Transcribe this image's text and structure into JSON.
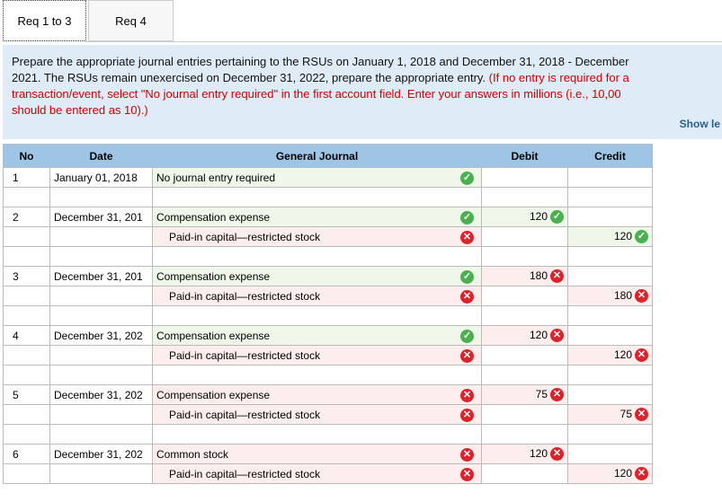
{
  "tabs": [
    {
      "label": "Req 1 to 3"
    },
    {
      "label": "Req 4"
    }
  ],
  "instructions": {
    "line1": "Prepare the appropriate journal entries pertaining to the RSUs on January 1, 2018 and December 31, 2018 - December",
    "line2a": "2021. The RSUs remain unexercised on December 31, 2022, prepare the appropriate entry. ",
    "line2b": "(If no entry is required for a",
    "line3": "transaction/event, select \"No journal entry required\" in the first account field. Enter your answers in millions (i.e., 10,00",
    "line4": "should be entered as 10).)"
  },
  "show_link": "Show le",
  "table": {
    "headers": {
      "no": "No",
      "date": "Date",
      "account": "General Journal",
      "debit": "Debit",
      "credit": "Credit"
    },
    "entries": [
      {
        "no": "1",
        "date": "January 01, 2018",
        "rows": [
          {
            "account": "No journal entry required",
            "acct_ok": true,
            "debit": "",
            "credit": ""
          }
        ]
      },
      {
        "no": "2",
        "date": "December 31, 201",
        "rows": [
          {
            "account": "Compensation expense",
            "acct_ok": true,
            "debit": "120",
            "debit_ok": true,
            "credit": ""
          },
          {
            "account": "Paid-in capital—restricted stock",
            "acct_ok": false,
            "debit": "",
            "credit": "120",
            "credit_ok": true
          }
        ]
      },
      {
        "no": "3",
        "date": "December 31, 201",
        "rows": [
          {
            "account": "Compensation expense",
            "acct_ok": true,
            "debit": "180",
            "debit_ok": false,
            "credit": ""
          },
          {
            "account": "Paid-in capital—restricted stock",
            "acct_ok": false,
            "debit": "",
            "credit": "180",
            "credit_ok": false
          }
        ]
      },
      {
        "no": "4",
        "date": "December 31, 202",
        "rows": [
          {
            "account": "Compensation expense",
            "acct_ok": true,
            "debit": "120",
            "debit_ok": false,
            "credit": ""
          },
          {
            "account": "Paid-in capital—restricted stock",
            "acct_ok": false,
            "debit": "",
            "credit": "120",
            "credit_ok": false
          }
        ]
      },
      {
        "no": "5",
        "date": "December 31, 202",
        "rows": [
          {
            "account": "Compensation expense",
            "acct_ok": false,
            "debit": "75",
            "debit_ok": false,
            "credit": ""
          },
          {
            "account": "Paid-in capital—restricted stock",
            "acct_ok": false,
            "debit": "",
            "credit": "75",
            "credit_ok": false
          }
        ]
      },
      {
        "no": "6",
        "date": "December 31, 202",
        "rows": [
          {
            "account": "Common stock",
            "acct_ok": false,
            "debit": "120",
            "debit_ok": false,
            "credit": ""
          },
          {
            "account": "Paid-in capital—restricted stock",
            "acct_ok": false,
            "debit": "",
            "credit": "120",
            "credit_ok": false
          }
        ]
      }
    ]
  },
  "icons": {
    "ok": "check-circle-icon",
    "bad": "x-circle-icon"
  }
}
